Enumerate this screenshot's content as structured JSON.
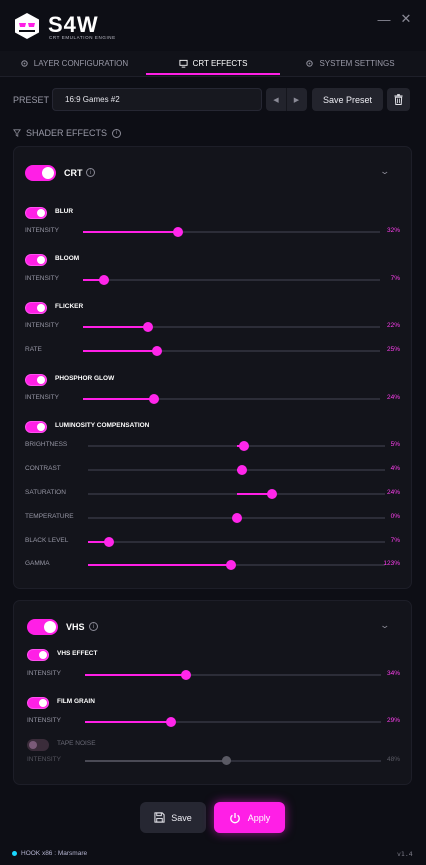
{
  "app": {
    "title": "S4W",
    "subtitle": "CRT EMULATION ENGINE",
    "minimize_icon": "minimize-icon",
    "close_icon": "close-icon"
  },
  "tabs": [
    {
      "label": "LAYER CONFIGURATION",
      "icon": "gear-icon",
      "active": false
    },
    {
      "label": "CRT EFFECTS",
      "icon": "monitor-icon",
      "active": true
    },
    {
      "label": "SYSTEM SETTINGS",
      "icon": "gear-icon",
      "active": false
    }
  ],
  "preset": {
    "label": "PRESET",
    "value": "16:9 Games #2",
    "save_label": "Save Preset",
    "trash_icon": "trash-icon"
  },
  "shader_effects": {
    "label": "SHADER EFFECTS",
    "icon": "filter-icon"
  },
  "crt": {
    "title": "CRT",
    "enabled": true,
    "effects": [
      {
        "label": "BLUR",
        "enabled": true,
        "params": [
          {
            "label": "INTENSITY",
            "value": "32%",
            "level": 0.32
          }
        ]
      },
      {
        "label": "BLOOM",
        "enabled": true,
        "params": [
          {
            "label": "INTENSITY",
            "value": "7%",
            "level": 0.07
          }
        ]
      },
      {
        "label": "FLICKER",
        "enabled": true,
        "params": [
          {
            "label": "INTENSITY",
            "value": "22%",
            "level": 0.22
          },
          {
            "label": "RATE",
            "value": "25%",
            "level": 0.25
          }
        ]
      },
      {
        "label": "PHOSPHOR GLOW",
        "enabled": true,
        "params": [
          {
            "label": "INTENSITY",
            "value": "24%",
            "level": 0.24
          }
        ]
      },
      {
        "label": "LUMINOSITY COMPENSATION",
        "enabled": true,
        "params": [
          {
            "label": "BRIGHTNESS",
            "value": "5%",
            "level": 0.05,
            "bipolar": true
          },
          {
            "label": "CONTRAST",
            "value": "4%",
            "level": 0.04,
            "bipolar": true
          },
          {
            "label": "SATURATION",
            "value": "24%",
            "level": 0.24,
            "bipolar": true
          },
          {
            "label": "TEMPERATURE",
            "value": "0%",
            "level": 0.0,
            "bipolar": true
          },
          {
            "label": "BLACK LEVEL",
            "value": "7%",
            "level": 0.07
          },
          {
            "label": "GAMMA",
            "value": "123%",
            "level": 0.48
          }
        ]
      }
    ]
  },
  "vhs": {
    "title": "VHS",
    "enabled": true,
    "effects": [
      {
        "label": "VHS EFFECT",
        "enabled": true,
        "params": [
          {
            "label": "INTENSITY",
            "value": "34%",
            "level": 0.34
          }
        ]
      },
      {
        "label": "FILM GRAIN",
        "enabled": true,
        "params": [
          {
            "label": "INTENSITY",
            "value": "29%",
            "level": 0.29
          }
        ]
      },
      {
        "label": "TAPE NOISE",
        "enabled": false,
        "params": [
          {
            "label": "INTENSITY",
            "value": "48%",
            "level": 0.48
          }
        ]
      }
    ]
  },
  "actions": {
    "save_label": "Save",
    "apply_label": "Apply"
  },
  "status": {
    "hook": "HOOK x86 : Marsmare",
    "version": "v1.4"
  },
  "colors": {
    "accent": "#ff1fe6",
    "background": "#0d0e15",
    "panel": "#13141b",
    "status_dot": "#19d7ff"
  }
}
